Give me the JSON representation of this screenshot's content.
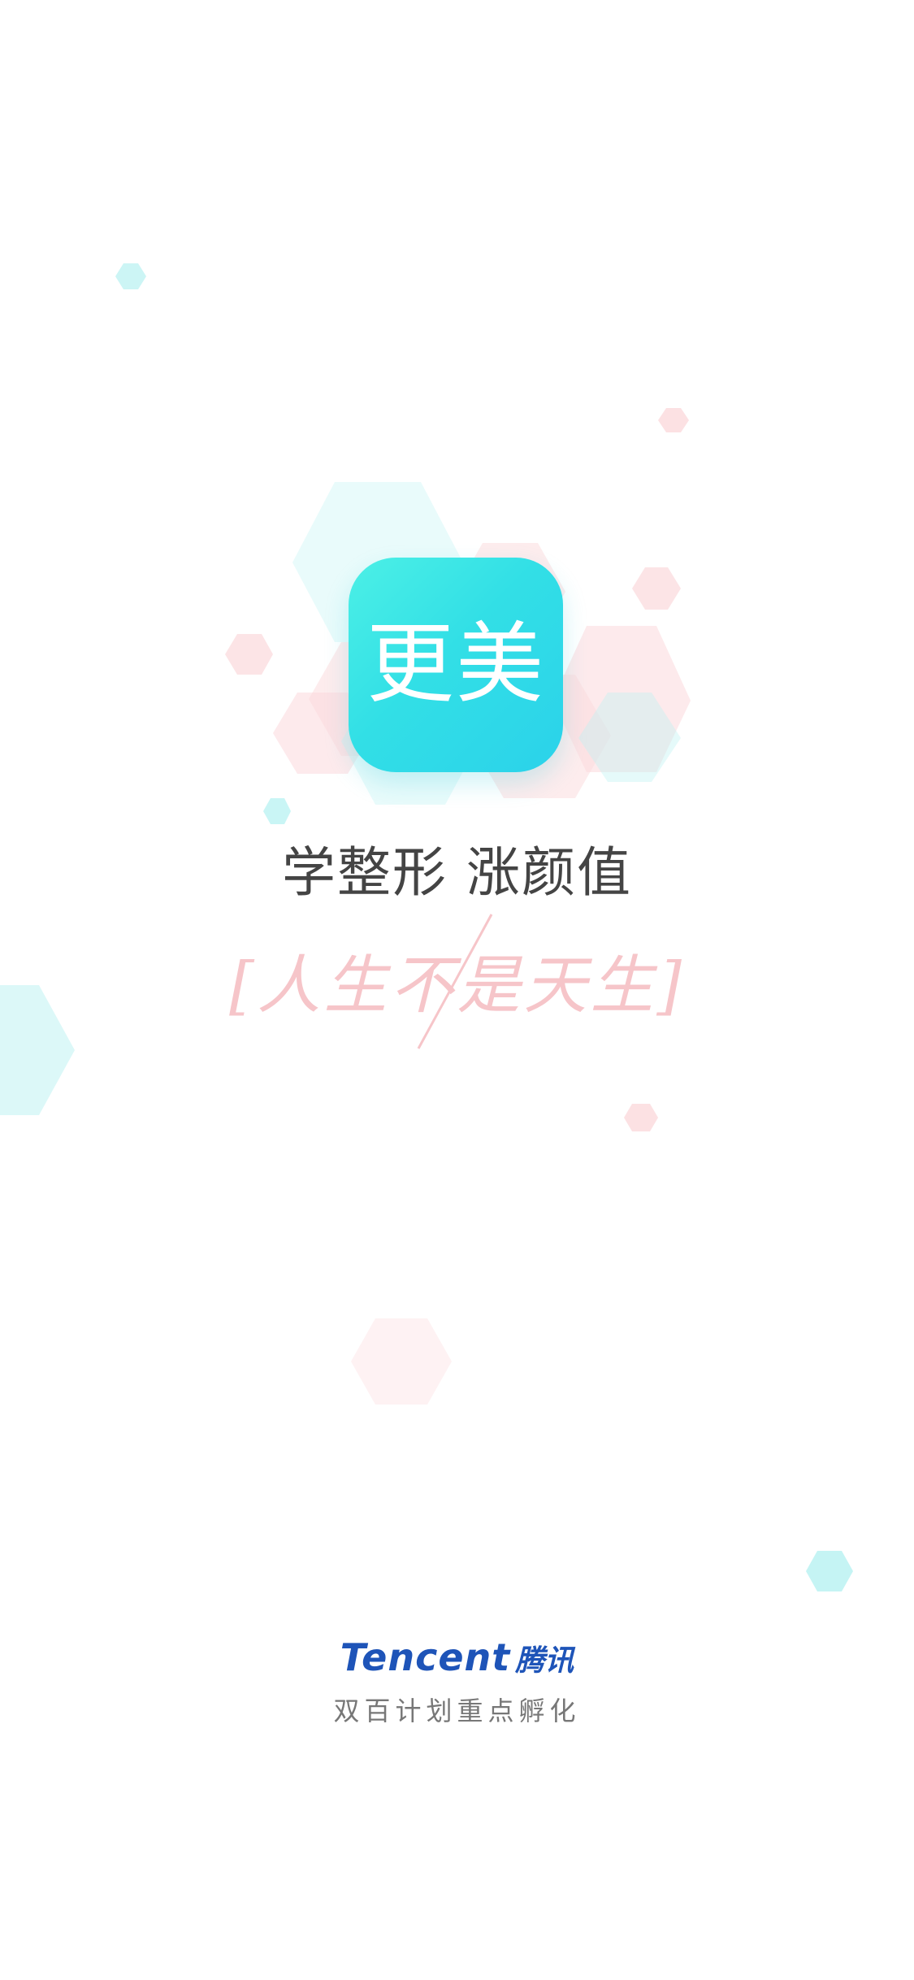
{
  "app_icon": {
    "label": "更美"
  },
  "slogan": "学整形 涨颜值",
  "tagline": "[人生不是天生]",
  "brand": {
    "name_en": "Tencent",
    "name_cn": "腾讯",
    "subtitle": "双百计划重点孵化"
  },
  "colors": {
    "icon_gradient_start": "#4cf0e6",
    "icon_gradient_end": "#2bd2ea",
    "slogan": "#444444",
    "tagline": "#f6c5c9",
    "brand": "#1e54b8",
    "hex_cyan": "#bff3f3",
    "hex_pink": "#fbd9dc"
  }
}
